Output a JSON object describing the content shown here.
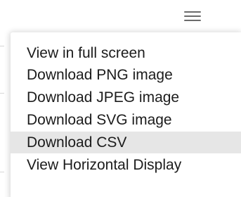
{
  "menu_button": {
    "icon": "hamburger-menu-icon"
  },
  "context_menu": {
    "items": [
      {
        "label": "View in full screen"
      },
      {
        "label": "Download PNG image"
      },
      {
        "label": "Download JPEG image"
      },
      {
        "label": "Download SVG image"
      },
      {
        "label": "Download CSV",
        "highlighted": true
      },
      {
        "label": "View Horizontal Display"
      }
    ]
  },
  "colors": {
    "menu_background": "#ffffff",
    "highlight_background": "#e6e6e6",
    "text": "#1c1c1c",
    "icon": "#6b6b6b"
  }
}
